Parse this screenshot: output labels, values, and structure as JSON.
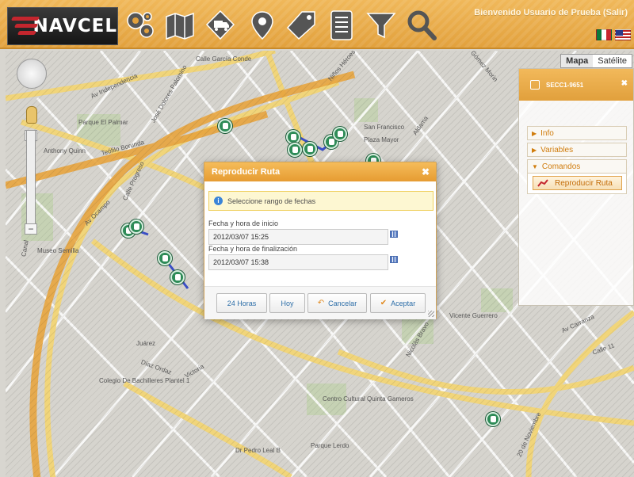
{
  "header": {
    "logo_text": "NAVCEL",
    "welcome": "Bienvenido Usuario de Prueba (Salir)",
    "toolbar": [
      {
        "name": "settings-gears-icon"
      },
      {
        "name": "map-icon"
      },
      {
        "name": "truck-icon"
      },
      {
        "name": "map-pin-icon"
      },
      {
        "name": "tag-icon"
      },
      {
        "name": "document-list-icon"
      },
      {
        "name": "filter-icon"
      },
      {
        "name": "search-icon"
      }
    ],
    "flags": [
      "mexico-flag-icon",
      "usa-flag-icon"
    ]
  },
  "map": {
    "map_type": [
      "Mapa",
      "Satélite"
    ],
    "map_type_selected": "Mapa",
    "street_labels": [
      "Av Independencia",
      "José Dolores Palomino",
      "Calle García Conde",
      "Niños Héroes",
      "Gómez Morin",
      "Parque El Palmar",
      "Teófilo Borunda",
      "Anthony Quinn",
      "Calle Progreso",
      "Av Ocampo",
      "San Francisco",
      "Plaza Mayor",
      "Aldama",
      "Juárez",
      "Díaz Ordaz",
      "Victoria",
      "Colegio De Bachilleres Plantel 1",
      "Centro Cultural Quinta Gameros",
      "Parque Lerdo",
      "Dr Pedro Leal B",
      "Calle 11",
      "Av Carranza",
      "20 de Noviembre",
      "Nicolás Bravo",
      "Museo Semilla",
      "Canal",
      "Vicente Guerrero"
    ]
  },
  "side_panel": {
    "vehicle": "SECC1-9651",
    "close": "✖",
    "sections": [
      "Info",
      "Variables",
      "Comandos"
    ],
    "command_button": "Reproducir Ruta"
  },
  "modal": {
    "title": "Reproducir Ruta",
    "close": "✖",
    "alert": "Seleccione rango de fechas",
    "start_label": "Fecha y hora de inicio",
    "start_value": "2012/03/07 15:25",
    "end_label": "Fecha y hora de finalización",
    "end_value": "2012/03/07 15:38",
    "buttons": {
      "hours24": "24 Horas",
      "today": "Hoy",
      "cancel": "Cancelar",
      "accept": "Aceptar"
    }
  },
  "colors": {
    "accent": "#e8a53f",
    "vehicle": "#2e8b57"
  }
}
